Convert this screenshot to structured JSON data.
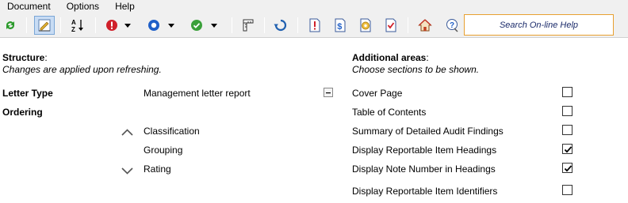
{
  "menu": [
    "Document",
    "Options",
    "Help"
  ],
  "toolbar": {
    "search_placeholder": "Search On-line Help",
    "icons": [
      "refresh-icon",
      "edit-structure-icon",
      "sort-az-icon",
      "red-status-icon",
      "blue-status-icon",
      "green-status-icon",
      "ruler-icon",
      "rotate-icon",
      "notes-doc-icon",
      "dollar-doc-icon",
      "settings-doc-icon",
      "checklist-doc-icon",
      "home-icon",
      "help-icon"
    ],
    "colors": {
      "red": "#d0202a",
      "blue": "#1f5fc8",
      "green": "#3aa03a"
    }
  },
  "structure": {
    "heading": "Structure",
    "subtitle": "Changes are applied upon refreshing.",
    "letter_type_label": "Letter Type",
    "letter_type_value": "Management letter report",
    "ordering_label": "Ordering",
    "ordering_items": [
      "Classification",
      "Grouping",
      "Rating"
    ]
  },
  "additional": {
    "heading": "Additional areas",
    "subtitle": "Choose sections to be shown.",
    "items": [
      {
        "label": "Cover Page",
        "checked": false
      },
      {
        "label": "Table of Contents",
        "checked": false
      },
      {
        "label": "Summary of Detailed Audit Findings",
        "checked": false
      },
      {
        "label": "Display Reportable Item Headings",
        "checked": true
      },
      {
        "label": "Display Note Number in Headings",
        "checked": true
      },
      {
        "label": "Display Reportable Item Identifiers",
        "checked": false
      }
    ]
  }
}
